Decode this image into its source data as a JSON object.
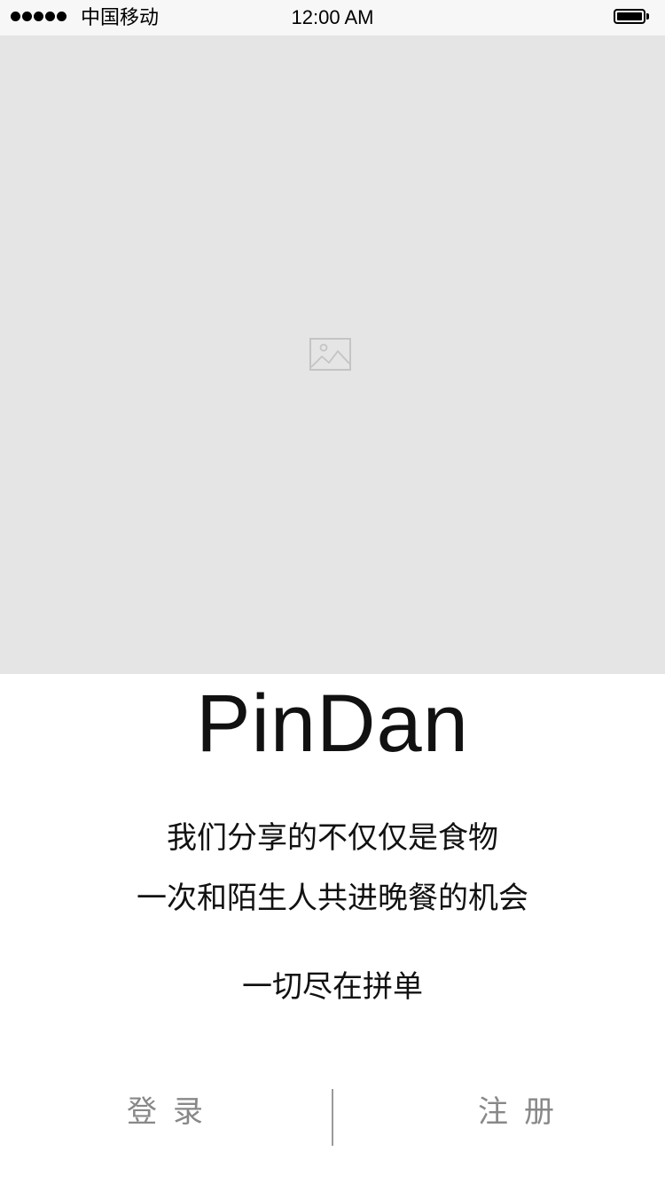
{
  "status_bar": {
    "carrier": "中国移动",
    "time": "12:00 AM",
    "signal_bars": 5
  },
  "hero": {
    "placeholder_icon": "image-placeholder-icon",
    "background_color": "#e5e5e5"
  },
  "brand": {
    "title": "PinDan"
  },
  "tagline": {
    "line1": "我们分享的不仅仅是食物",
    "line2": "一次和陌生人共进晚餐的机会",
    "line3": "一切尽在拼单"
  },
  "actions": {
    "login_label": "登录",
    "register_label": "注册",
    "label_color": "#888888"
  }
}
